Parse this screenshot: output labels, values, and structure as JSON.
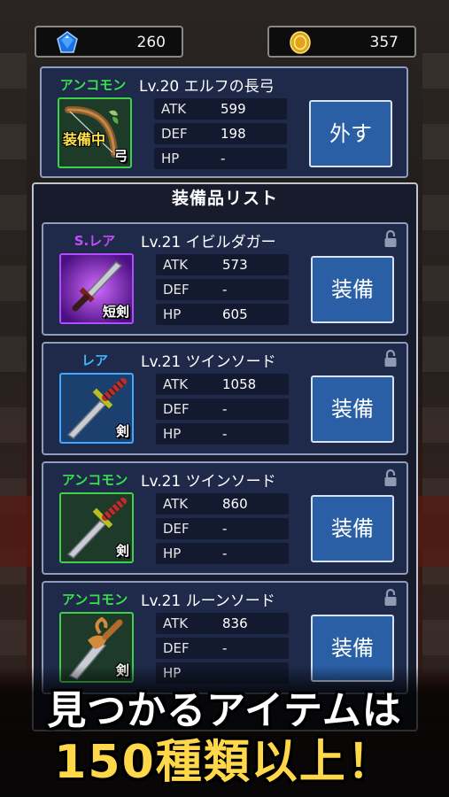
{
  "header": {
    "gems": "260",
    "coins": "357",
    "gem_icon": "blue-gem-icon",
    "coin_icon": "gold-coin-icon"
  },
  "equipped": {
    "rarity": "アンコモン",
    "rarity_color": "#35e24a",
    "name": "Lv.20 エルフの長弓",
    "status_tag": "装備中",
    "weapon_type": "弓",
    "icon": "bow-icon",
    "stats": [
      {
        "key": "ATK",
        "value": "599"
      },
      {
        "key": "DEF",
        "value": "198"
      },
      {
        "key": "HP",
        "value": "-"
      }
    ],
    "action_label": "外す"
  },
  "list": {
    "title": "装備品リスト",
    "items": [
      {
        "rarity": "S.レア",
        "rarity_color": "#c44cff",
        "name": "Lv.21 イビルダガー",
        "weapon_type": "短剣",
        "icon": "evil-dagger-icon",
        "stats": [
          {
            "key": "ATK",
            "value": "573"
          },
          {
            "key": "DEF",
            "value": "-"
          },
          {
            "key": "HP",
            "value": "605"
          }
        ],
        "action_label": "装備"
      },
      {
        "rarity": "レア",
        "rarity_color": "#3fb6ff",
        "name": "Lv.21 ツインソード",
        "weapon_type": "剣",
        "icon": "twin-sword-icon",
        "stats": [
          {
            "key": "ATK",
            "value": "1058"
          },
          {
            "key": "DEF",
            "value": "-"
          },
          {
            "key": "HP",
            "value": "-"
          }
        ],
        "action_label": "装備"
      },
      {
        "rarity": "アンコモン",
        "rarity_color": "#35e24a",
        "name": "Lv.21 ツインソード",
        "weapon_type": "剣",
        "icon": "twin-sword-icon",
        "stats": [
          {
            "key": "ATK",
            "value": "860"
          },
          {
            "key": "DEF",
            "value": "-"
          },
          {
            "key": "HP",
            "value": "-"
          }
        ],
        "action_label": "装備"
      },
      {
        "rarity": "アンコモン",
        "rarity_color": "#35e24a",
        "name": "Lv.21 ルーンソード",
        "weapon_type": "剣",
        "icon": "rune-sword-icon",
        "stats": [
          {
            "key": "ATK",
            "value": "836"
          },
          {
            "key": "DEF",
            "value": "-"
          },
          {
            "key": "HP",
            "value": ""
          }
        ],
        "action_label": "装備"
      }
    ]
  },
  "banner": {
    "line1": "見つかるアイテムは",
    "line2": "150種類以上！"
  }
}
